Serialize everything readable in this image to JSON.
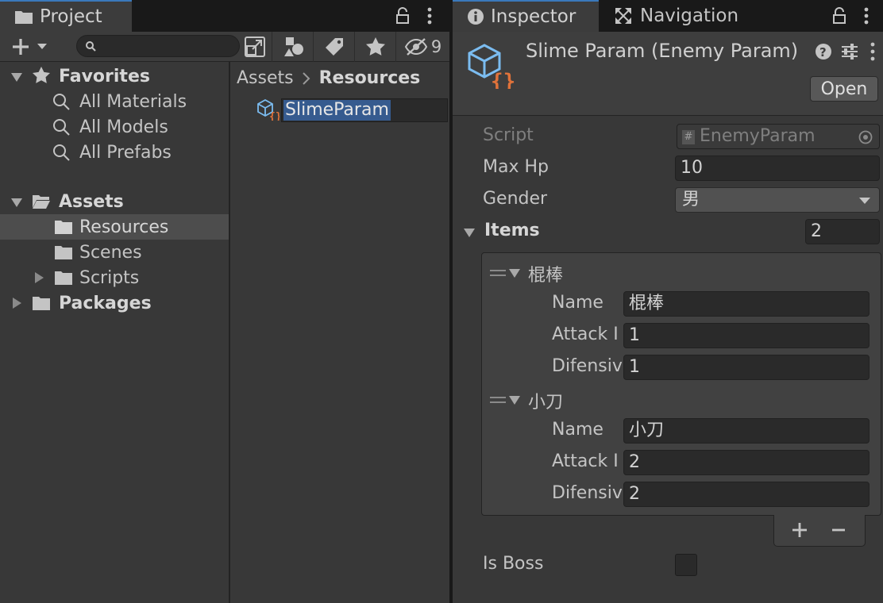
{
  "project": {
    "tab_label": "Project",
    "hidden_count": "9",
    "search": {
      "value": ""
    },
    "tree": {
      "favorites_label": "Favorites",
      "favorites": [
        "All Materials",
        "All Models",
        "All Prefabs"
      ],
      "assets_label": "Assets",
      "assets_children": [
        "Resources",
        "Scenes",
        "Scripts"
      ],
      "packages_label": "Packages"
    },
    "breadcrumb": {
      "root": "Assets",
      "current": "Resources"
    },
    "asset_item": {
      "name": "SlimeParam"
    }
  },
  "inspector": {
    "tab_label": "Inspector",
    "nav_tab_label": "Navigation",
    "object_title": "Slime Param (Enemy Param)",
    "open_label": "Open",
    "fields": {
      "script_label": "Script",
      "script_value": "EnemyParam",
      "maxhp_label": "Max Hp",
      "maxhp_value": "10",
      "gender_label": "Gender",
      "gender_value": "男",
      "items_label": "Items",
      "items_count": "2",
      "isboss_label": "Is Boss"
    },
    "items": [
      {
        "header": "棍棒",
        "name_label": "Name",
        "name_value": "棍棒",
        "attack_label": "Attack I",
        "attack_value": "1",
        "defense_label": "Difensiv",
        "defense_value": "1"
      },
      {
        "header": "小刀",
        "name_label": "Name",
        "name_value": "小刀",
        "attack_label": "Attack I",
        "attack_value": "2",
        "defense_label": "Difensiv",
        "defense_value": "2"
      }
    ]
  },
  "colors": {
    "selection": "#365b8f",
    "tab_accent": "#3a79bb",
    "script_icon_orange": "#e0723a",
    "script_icon_blue": "#7bbcf0"
  }
}
